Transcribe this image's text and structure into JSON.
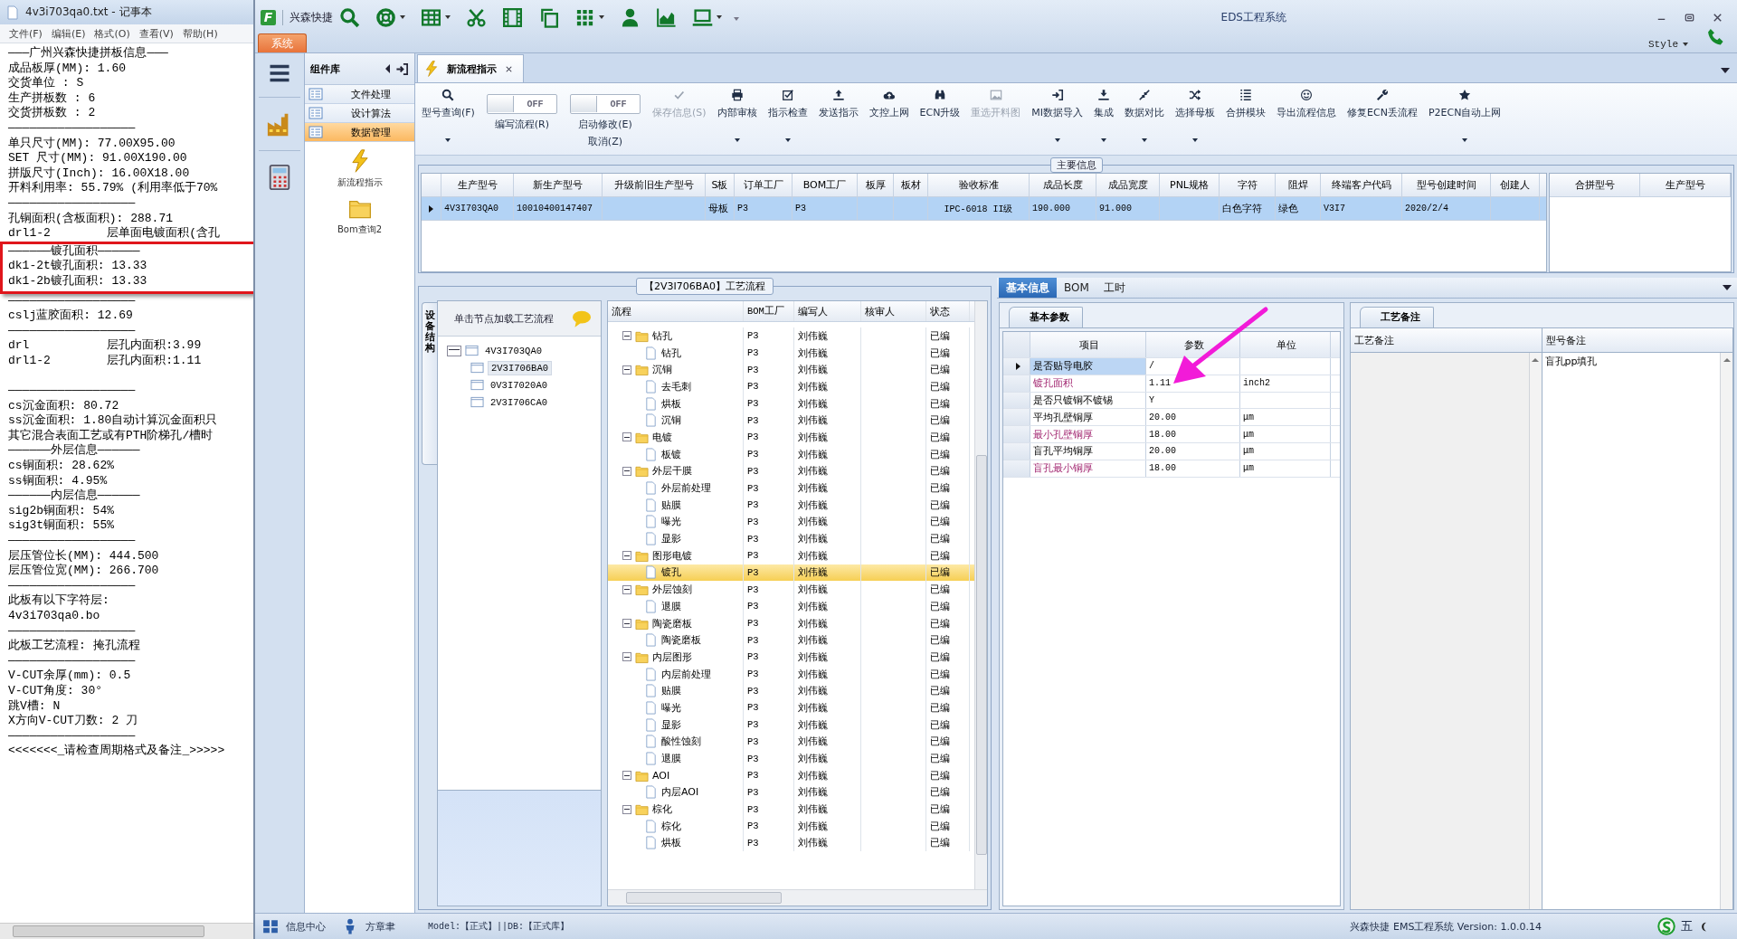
{
  "notepad": {
    "title": "4v3i703qa0.txt - 记事本",
    "menu": [
      "文件(F)",
      "编辑(E)",
      "格式(O)",
      "查看(V)",
      "帮助(H)"
    ],
    "blocks": [
      {
        "highlighted": false,
        "lines": [
          "———广州兴森快捷拼板信息———",
          "成品板厚(MM): 1.60",
          "交货单位 : S",
          "生产拼板数 : 6",
          "交货拼板数 : 2",
          "——————————————————",
          "单只尺寸(MM): 77.00X95.00",
          "SET 尺寸(MM): 91.00X190.00",
          "拼版尺寸(Inch): 16.00X18.00",
          "开料利用率: 55.79% (利用率低于70%",
          "——————————————————",
          "孔铜面积(含板面积): 288.71",
          "drl1-2        层单面电镀面积(含孔"
        ]
      },
      {
        "highlighted": true,
        "lines": [
          "——————镀孔面积——————",
          "dk1-2t镀孔面积: 13.33",
          "dk1-2b镀孔面积: 13.33"
        ]
      },
      {
        "highlighted": false,
        "lines": [
          "——————————————————",
          "cslj蓝胶面积: 12.69",
          "——————————————————",
          "drl           层孔内面积:3.99",
          "drl1-2        层孔内面积:1.11"
        ]
      },
      {
        "highlighted": false,
        "space_before": true,
        "lines": [
          "——————————————————",
          "cs沉金面积: 80.72",
          "ss沉金面积: 1.80自动计算沉金面积只",
          "其它混合表面工艺或有PTH阶梯孔/槽时",
          "——————外层信息——————",
          "cs铜面积: 28.62%",
          "ss铜面积: 4.95%",
          "——————内层信息——————",
          "sig2b铜面积: 54%",
          "sig3t铜面积: 55%",
          "——————————————————",
          "层压管位长(MM): 444.500",
          "层压管位宽(MM): 266.700",
          "——————————————————",
          "此板有以下字符层:",
          "4v3i703qa0.bo",
          "——————————————————",
          "此板工艺流程: 掩孔流程",
          "——————————————————",
          "V-CUT余厚(mm): 0.5",
          "V-CUT角度: 30°",
          "跳V槽: N",
          "X方向V-CUT刀数: 2 刀",
          "——————————————————",
          "<<<<<<<_请检查周期格式及备注_>>>>>"
        ]
      }
    ]
  },
  "app": {
    "logo": "F",
    "brand": "兴森快捷",
    "title": "EDS工程系统",
    "menu_tab": "系统",
    "style_menu": "Style",
    "quick_access": [
      {
        "dropdown": false
      },
      {
        "dropdown": true
      },
      {
        "dropdown": true
      },
      {
        "dropdown": false
      },
      {
        "dropdown": false
      },
      {
        "dropdown": false
      },
      {
        "dropdown": true
      },
      {
        "dropdown": false
      },
      {
        "dropdown": false
      },
      {
        "dropdown": true
      }
    ]
  },
  "nav": {
    "panel_title": "组件库",
    "items": [
      {
        "label": "文件处理",
        "selected": false
      },
      {
        "label": "设计算法",
        "selected": false
      },
      {
        "label": "数据管理",
        "selected": true
      }
    ],
    "tools": [
      "新流程指示",
      "Bom查询2"
    ]
  },
  "document_tab": {
    "label": "新流程指示"
  },
  "ribbon": [
    {
      "kind": "button",
      "label": "型号查询(F)",
      "disabled": false,
      "dropdown": true
    },
    {
      "kind": "toggle",
      "switch": "OFF",
      "on": false,
      "label": "编写流程(R)"
    },
    {
      "kind": "toggle",
      "switch": "OFF",
      "on": false,
      "label": "启动修改(E)",
      "label2": "取消(Z)"
    },
    {
      "kind": "button",
      "label": "保存信息(S)",
      "disabled": true,
      "dropdown": false
    },
    {
      "kind": "button",
      "label": "内部审核",
      "disabled": false,
      "dropdown": true
    },
    {
      "kind": "button",
      "label": "指示检查",
      "disabled": false,
      "dropdown": true
    },
    {
      "kind": "button",
      "label": "发送指示",
      "disabled": false,
      "dropdown": false
    },
    {
      "kind": "button",
      "label": "文控上网",
      "disabled": false,
      "dropdown": false
    },
    {
      "kind": "button",
      "label": "ECN升级",
      "disabled": false,
      "dropdown": false
    },
    {
      "kind": "button",
      "label": "重选开料图",
      "disabled": true,
      "dropdown": false
    },
    {
      "kind": "button",
      "label": "MI数据导入",
      "disabled": false,
      "dropdown": true
    },
    {
      "kind": "button",
      "label": "集成",
      "disabled": false,
      "dropdown": true
    },
    {
      "kind": "button",
      "label": "数据对比",
      "disabled": false,
      "dropdown": true
    },
    {
      "kind": "button",
      "label": "选择母板",
      "disabled": false,
      "dropdown": true
    },
    {
      "kind": "button",
      "label": "合拼模块",
      "disabled": false,
      "dropdown": false
    },
    {
      "kind": "button",
      "label": "导出流程信息",
      "disabled": false,
      "dropdown": false
    },
    {
      "kind": "button",
      "label": "修复ECN丢流程",
      "disabled": false,
      "dropdown": false
    },
    {
      "kind": "button",
      "label": "P2ECN自动上网",
      "disabled": false,
      "dropdown": true
    }
  ],
  "main_info": {
    "title": "主要信息",
    "columns": [
      "生产型号",
      "新生产型号",
      "升级前旧生产型号",
      "S板",
      "订单工厂",
      "BOM工厂",
      "板厚",
      "板材",
      "验收标准",
      "成品长度",
      "成品宽度",
      "PNL规格",
      "字符",
      "阻焊",
      "终端客户代码",
      "型号创建时间",
      "创建人"
    ],
    "rows": [
      {
        "selected": true,
        "cells": [
          "4V3I703QA0",
          "10010400147407",
          null,
          "母板",
          "P3",
          "P3",
          null,
          null,
          "IPC-6018 II级",
          "190.000",
          "91.000",
          null,
          "白色字符",
          "绿色",
          "V3I7",
          "2020/2/4",
          null
        ]
      }
    ],
    "side_columns": [
      "合拼型号",
      "生产型号"
    ]
  },
  "process": {
    "title": "【2V3I706BA0】工艺流程",
    "side_tab": "设备结构",
    "hint": "单击节点加载工艺流程",
    "tree": [
      {
        "label": "4V3I703QA0",
        "expanded": true,
        "children": [
          {
            "label": "2V3I706BA0",
            "selected": true
          },
          {
            "label": "0V3I7020A0",
            "selected": false
          },
          {
            "label": "2V3I706CA0",
            "selected": false
          }
        ]
      }
    ],
    "columns": [
      "流程",
      "BOM工厂",
      "编写人",
      "核审人",
      "状态"
    ],
    "steps": [
      {
        "label": "钻孔",
        "expanded": true,
        "selected": false,
        "bom": "P3",
        "writer": "刘伟巍",
        "status": "已编",
        "children": [
          {
            "label": "钻孔",
            "selected": false,
            "bom": "P3",
            "writer": "刘伟巍",
            "status": "已编"
          }
        ]
      },
      {
        "label": "沉铜",
        "expanded": true,
        "selected": false,
        "bom": "P3",
        "writer": "刘伟巍",
        "status": "已编",
        "children": [
          {
            "label": "去毛刺",
            "selected": false,
            "bom": "P3",
            "writer": "刘伟巍",
            "status": "已编"
          },
          {
            "label": "烘板",
            "selected": false,
            "bom": "P3",
            "writer": "刘伟巍",
            "status": "已编"
          },
          {
            "label": "沉铜",
            "selected": false,
            "bom": "P3",
            "writer": "刘伟巍",
            "status": "已编"
          }
        ]
      },
      {
        "label": "电镀",
        "expanded": true,
        "selected": false,
        "bom": "P3",
        "writer": "刘伟巍",
        "status": "已编",
        "children": [
          {
            "label": "板镀",
            "selected": false,
            "bom": "P3",
            "writer": "刘伟巍",
            "status": "已编"
          }
        ]
      },
      {
        "label": "外层干膜",
        "expanded": true,
        "selected": false,
        "bom": "P3",
        "writer": "刘伟巍",
        "status": "已编",
        "children": [
          {
            "label": "外层前处理",
            "selected": false,
            "bom": "P3",
            "writer": "刘伟巍",
            "status": "已编"
          },
          {
            "label": "贴膜",
            "selected": false,
            "bom": "P3",
            "writer": "刘伟巍",
            "status": "已编"
          },
          {
            "label": "曝光",
            "selected": false,
            "bom": "P3",
            "writer": "刘伟巍",
            "status": "已编"
          },
          {
            "label": "显影",
            "selected": false,
            "bom": "P3",
            "writer": "刘伟巍",
            "status": "已编"
          }
        ]
      },
      {
        "label": "图形电镀",
        "expanded": true,
        "selected": false,
        "bom": "P3",
        "writer": "刘伟巍",
        "status": "已编",
        "children": [
          {
            "label": "镀孔",
            "selected": true,
            "bom": "P3",
            "writer": "刘伟巍",
            "status": "已编"
          }
        ]
      },
      {
        "label": "外层蚀刻",
        "expanded": true,
        "selected": false,
        "bom": "P3",
        "writer": "刘伟巍",
        "status": "已编",
        "children": [
          {
            "label": "退膜",
            "selected": false,
            "bom": "P3",
            "writer": "刘伟巍",
            "status": "已编"
          }
        ]
      },
      {
        "label": "陶瓷磨板",
        "expanded": true,
        "selected": false,
        "bom": "P3",
        "writer": "刘伟巍",
        "status": "已编",
        "children": [
          {
            "label": "陶瓷磨板",
            "selected": false,
            "bom": "P3",
            "writer": "刘伟巍",
            "status": "已编"
          }
        ]
      },
      {
        "label": "内层图形",
        "expanded": true,
        "selected": false,
        "bom": "P3",
        "writer": "刘伟巍",
        "status": "已编",
        "children": [
          {
            "label": "内层前处理",
            "selected": false,
            "bom": "P3",
            "writer": "刘伟巍",
            "status": "已编"
          },
          {
            "label": "贴膜",
            "selected": false,
            "bom": "P3",
            "writer": "刘伟巍",
            "status": "已编"
          },
          {
            "label": "曝光",
            "selected": false,
            "bom": "P3",
            "writer": "刘伟巍",
            "status": "已编"
          },
          {
            "label": "显影",
            "selected": false,
            "bom": "P3",
            "writer": "刘伟巍",
            "status": "已编"
          },
          {
            "label": "酸性蚀刻",
            "selected": false,
            "bom": "P3",
            "writer": "刘伟巍",
            "status": "已编"
          },
          {
            "label": "退膜",
            "selected": false,
            "bom": "P3",
            "writer": "刘伟巍",
            "status": "已编"
          }
        ]
      },
      {
        "label": "AOI",
        "expanded": true,
        "selected": false,
        "bom": "P3",
        "writer": "刘伟巍",
        "status": "已编",
        "children": [
          {
            "label": "内层AOI",
            "selected": false,
            "bom": "P3",
            "writer": "刘伟巍",
            "status": "已编"
          }
        ]
      },
      {
        "label": "棕化",
        "expanded": true,
        "selected": false,
        "bom": "P3",
        "writer": "刘伟巍",
        "status": "已编",
        "children": [
          {
            "label": "棕化",
            "selected": false,
            "bom": "P3",
            "writer": "刘伟巍",
            "status": "已编"
          },
          {
            "label": "烘板",
            "selected": false,
            "bom": "P3",
            "writer": "刘伟巍",
            "status": "已编"
          }
        ]
      }
    ]
  },
  "details": {
    "tabs": [
      {
        "label": "基本信息",
        "selected": true
      },
      {
        "label": "BOM",
        "selected": false
      },
      {
        "label": "工时",
        "selected": false
      }
    ],
    "params_tab": "基本参数",
    "param_columns": [
      "项目",
      "参数",
      "单位"
    ],
    "params": [
      {
        "item": "是否贴导电胶",
        "value": "/",
        "selected": true,
        "emphasized": false
      },
      {
        "item": "镀孔面积",
        "value": "1.11",
        "unit": "inch2",
        "selected": false,
        "emphasized": true
      },
      {
        "item": "是否只镀铜不镀锡",
        "value": "Y",
        "selected": false,
        "emphasized": false
      },
      {
        "item": "平均孔壁铜厚",
        "value": "20.00",
        "unit": "μm",
        "selected": false,
        "emphasized": false
      },
      {
        "item": "最小孔壁铜厚",
        "value": "18.00",
        "unit": "μm",
        "selected": false,
        "emphasized": true
      },
      {
        "item": "盲孔平均铜厚",
        "value": "20.00",
        "unit": "μm",
        "selected": false,
        "emphasized": false
      },
      {
        "item": "盲孔最小铜厚",
        "value": "18.00",
        "unit": "μm",
        "selected": false,
        "emphasized": true
      }
    ],
    "notes_tab": "工艺备注",
    "notes_columns": [
      "工艺备注",
      "型号备注"
    ],
    "model_note": "盲孔pp填孔"
  },
  "annotations": [
    {
      "kind": "arrow"
    }
  ],
  "status_bar": {
    "items": [
      "信息中心",
      "方章聿"
    ],
    "model": "Model:【正式】||DB:【正式库】",
    "version": "兴森快捷 EMS工程系统 Version: 1.0.0.14",
    "tray": "五"
  }
}
